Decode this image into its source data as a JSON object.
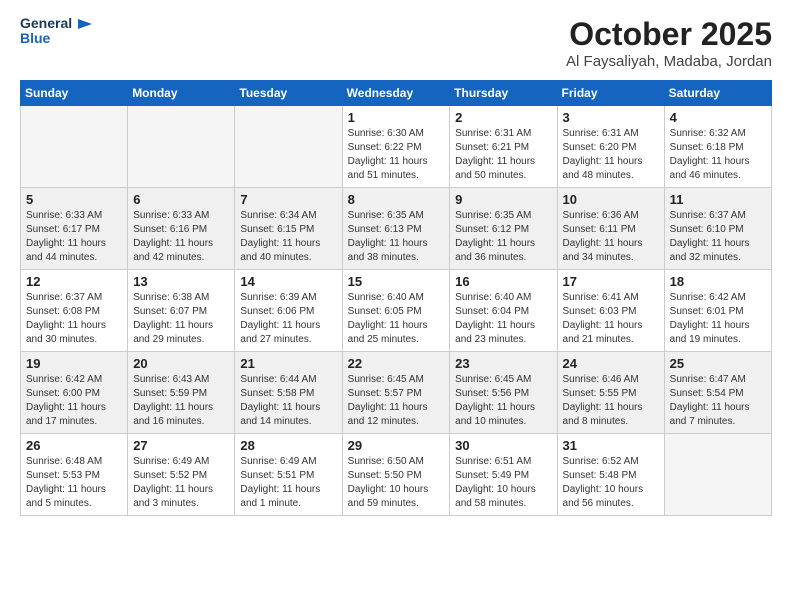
{
  "header": {
    "logo_line1": "General",
    "logo_line2": "Blue",
    "month": "October 2025",
    "location": "Al Faysaliyah, Madaba, Jordan"
  },
  "weekdays": [
    "Sunday",
    "Monday",
    "Tuesday",
    "Wednesday",
    "Thursday",
    "Friday",
    "Saturday"
  ],
  "weeks": [
    [
      {
        "day": "",
        "info": ""
      },
      {
        "day": "",
        "info": ""
      },
      {
        "day": "",
        "info": ""
      },
      {
        "day": "1",
        "info": "Sunrise: 6:30 AM\nSunset: 6:22 PM\nDaylight: 11 hours\nand 51 minutes."
      },
      {
        "day": "2",
        "info": "Sunrise: 6:31 AM\nSunset: 6:21 PM\nDaylight: 11 hours\nand 50 minutes."
      },
      {
        "day": "3",
        "info": "Sunrise: 6:31 AM\nSunset: 6:20 PM\nDaylight: 11 hours\nand 48 minutes."
      },
      {
        "day": "4",
        "info": "Sunrise: 6:32 AM\nSunset: 6:18 PM\nDaylight: 11 hours\nand 46 minutes."
      }
    ],
    [
      {
        "day": "5",
        "info": "Sunrise: 6:33 AM\nSunset: 6:17 PM\nDaylight: 11 hours\nand 44 minutes."
      },
      {
        "day": "6",
        "info": "Sunrise: 6:33 AM\nSunset: 6:16 PM\nDaylight: 11 hours\nand 42 minutes."
      },
      {
        "day": "7",
        "info": "Sunrise: 6:34 AM\nSunset: 6:15 PM\nDaylight: 11 hours\nand 40 minutes."
      },
      {
        "day": "8",
        "info": "Sunrise: 6:35 AM\nSunset: 6:13 PM\nDaylight: 11 hours\nand 38 minutes."
      },
      {
        "day": "9",
        "info": "Sunrise: 6:35 AM\nSunset: 6:12 PM\nDaylight: 11 hours\nand 36 minutes."
      },
      {
        "day": "10",
        "info": "Sunrise: 6:36 AM\nSunset: 6:11 PM\nDaylight: 11 hours\nand 34 minutes."
      },
      {
        "day": "11",
        "info": "Sunrise: 6:37 AM\nSunset: 6:10 PM\nDaylight: 11 hours\nand 32 minutes."
      }
    ],
    [
      {
        "day": "12",
        "info": "Sunrise: 6:37 AM\nSunset: 6:08 PM\nDaylight: 11 hours\nand 30 minutes."
      },
      {
        "day": "13",
        "info": "Sunrise: 6:38 AM\nSunset: 6:07 PM\nDaylight: 11 hours\nand 29 minutes."
      },
      {
        "day": "14",
        "info": "Sunrise: 6:39 AM\nSunset: 6:06 PM\nDaylight: 11 hours\nand 27 minutes."
      },
      {
        "day": "15",
        "info": "Sunrise: 6:40 AM\nSunset: 6:05 PM\nDaylight: 11 hours\nand 25 minutes."
      },
      {
        "day": "16",
        "info": "Sunrise: 6:40 AM\nSunset: 6:04 PM\nDaylight: 11 hours\nand 23 minutes."
      },
      {
        "day": "17",
        "info": "Sunrise: 6:41 AM\nSunset: 6:03 PM\nDaylight: 11 hours\nand 21 minutes."
      },
      {
        "day": "18",
        "info": "Sunrise: 6:42 AM\nSunset: 6:01 PM\nDaylight: 11 hours\nand 19 minutes."
      }
    ],
    [
      {
        "day": "19",
        "info": "Sunrise: 6:42 AM\nSunset: 6:00 PM\nDaylight: 11 hours\nand 17 minutes."
      },
      {
        "day": "20",
        "info": "Sunrise: 6:43 AM\nSunset: 5:59 PM\nDaylight: 11 hours\nand 16 minutes."
      },
      {
        "day": "21",
        "info": "Sunrise: 6:44 AM\nSunset: 5:58 PM\nDaylight: 11 hours\nand 14 minutes."
      },
      {
        "day": "22",
        "info": "Sunrise: 6:45 AM\nSunset: 5:57 PM\nDaylight: 11 hours\nand 12 minutes."
      },
      {
        "day": "23",
        "info": "Sunrise: 6:45 AM\nSunset: 5:56 PM\nDaylight: 11 hours\nand 10 minutes."
      },
      {
        "day": "24",
        "info": "Sunrise: 6:46 AM\nSunset: 5:55 PM\nDaylight: 11 hours\nand 8 minutes."
      },
      {
        "day": "25",
        "info": "Sunrise: 6:47 AM\nSunset: 5:54 PM\nDaylight: 11 hours\nand 7 minutes."
      }
    ],
    [
      {
        "day": "26",
        "info": "Sunrise: 6:48 AM\nSunset: 5:53 PM\nDaylight: 11 hours\nand 5 minutes."
      },
      {
        "day": "27",
        "info": "Sunrise: 6:49 AM\nSunset: 5:52 PM\nDaylight: 11 hours\nand 3 minutes."
      },
      {
        "day": "28",
        "info": "Sunrise: 6:49 AM\nSunset: 5:51 PM\nDaylight: 11 hours\nand 1 minute."
      },
      {
        "day": "29",
        "info": "Sunrise: 6:50 AM\nSunset: 5:50 PM\nDaylight: 10 hours\nand 59 minutes."
      },
      {
        "day": "30",
        "info": "Sunrise: 6:51 AM\nSunset: 5:49 PM\nDaylight: 10 hours\nand 58 minutes."
      },
      {
        "day": "31",
        "info": "Sunrise: 6:52 AM\nSunset: 5:48 PM\nDaylight: 10 hours\nand 56 minutes."
      },
      {
        "day": "",
        "info": ""
      }
    ]
  ]
}
